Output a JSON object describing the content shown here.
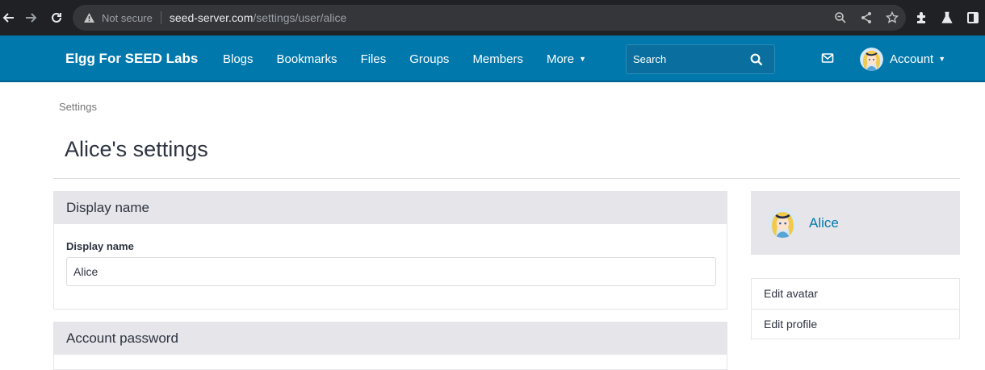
{
  "browser": {
    "security_label": "Not secure",
    "url_host": "seed-server.com",
    "url_path": "/settings/user/alice"
  },
  "site": {
    "brand": "Elgg For SEED Labs",
    "menu": [
      "Blogs",
      "Bookmarks",
      "Files",
      "Groups",
      "Members",
      "More"
    ],
    "search_placeholder": "Search",
    "account_label": "Account",
    "accent_color": "#0078ac"
  },
  "page": {
    "breadcrumb": "Settings",
    "title": "Alice's settings"
  },
  "display_name_module": {
    "heading": "Display name",
    "field_label": "Display name",
    "field_value": "Alice"
  },
  "password_module": {
    "heading": "Account password"
  },
  "sidebar": {
    "owner_name": "Alice",
    "menu": [
      "Edit avatar",
      "Edit profile"
    ]
  },
  "icons": [
    "back-arrow-icon",
    "forward-arrow-icon",
    "reload-icon",
    "warning-icon",
    "zoom-icon",
    "share-icon",
    "star-icon",
    "extensions-icon",
    "lab-icon",
    "sidebar-icon",
    "search-icon",
    "mail-icon",
    "chevron-down-icon"
  ]
}
